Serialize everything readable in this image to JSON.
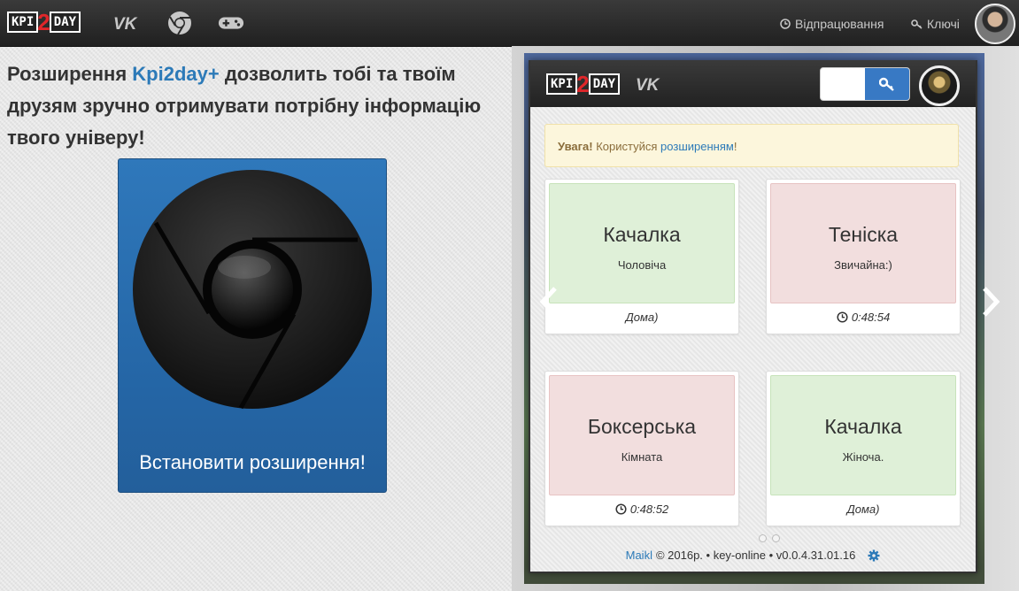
{
  "navbar": {
    "logo": {
      "left": "KPI",
      "mid": "2",
      "right": "DAY"
    },
    "icons": [
      "vk-icon",
      "chrome-icon",
      "gamepad-icon"
    ],
    "links": [
      {
        "icon": "clock-icon",
        "label": "Відпрацювання"
      },
      {
        "icon": "key-icon",
        "label": "Ключі"
      }
    ]
  },
  "promo": {
    "text_before": "Розширення ",
    "brand": "Kpi2day+",
    "text_after": " дозволить тобі та твоїм друзям зручно отримувати потрібну інформацію твого універу!",
    "install_label": "Встановити розширення!"
  },
  "popup": {
    "logo": {
      "left": "KPI",
      "mid": "2",
      "right": "DAY"
    },
    "alert": {
      "strong": "Увага!",
      "text": " Користуйся ",
      "link": "розширенням",
      "end": "!"
    },
    "cards": [
      {
        "title": "Качалка",
        "subtitle": "Чоловіча",
        "footer": "Дома)",
        "color": "green",
        "timer": false
      },
      {
        "title": "Теніска",
        "subtitle": "Звичайна:)",
        "footer": "0:48:54",
        "color": "red",
        "timer": true
      },
      {
        "title": "Боксерська",
        "subtitle": "Кімната",
        "footer": "0:48:52",
        "color": "red",
        "timer": true
      },
      {
        "title": "Качалка",
        "subtitle": "Жіноча.",
        "footer": "Дома)",
        "color": "green",
        "timer": false
      }
    ],
    "footer": {
      "author": "Maikl",
      "text": "© 2016р. • key-online • v0.0.4.31.01.16",
      "icon": "gear-icon"
    }
  },
  "colors": {
    "brand": "#2c7ab8",
    "logo_red": "#e0262a",
    "green_card": "#dff0d8",
    "red_card": "#f2dede",
    "navbar": "#2a2a2a"
  }
}
